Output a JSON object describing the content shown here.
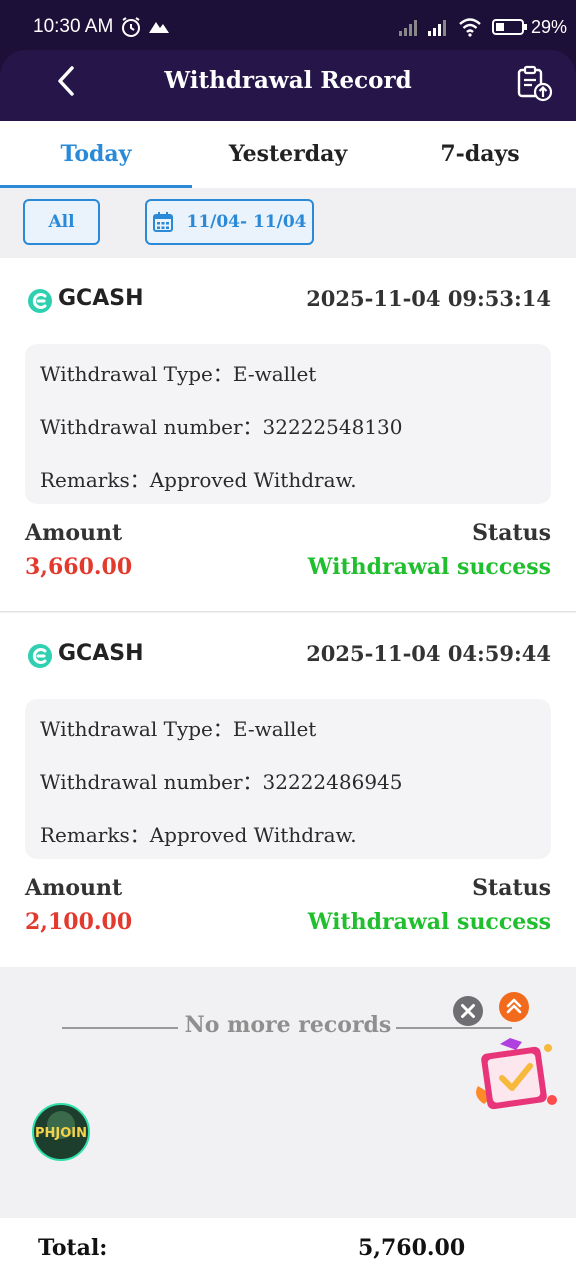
{
  "status_bar": {
    "time": "10:30 AM",
    "battery_pct": "29%",
    "icons": [
      "alarm-icon",
      "mountain-icon",
      "signal-icon",
      "signal-icon",
      "wifi-icon",
      "battery-icon"
    ]
  },
  "header": {
    "title": "Withdrawal Record",
    "back_icon": "chevron-left-icon",
    "right_icon": "clipboard-upload-icon",
    "background": "#1c0f38"
  },
  "tabs": [
    {
      "label": "Today",
      "active": true
    },
    {
      "label": "Yesterday",
      "active": false
    },
    {
      "label": "7-days",
      "active": false
    }
  ],
  "filters": {
    "all_label": "All",
    "date_range": "11/04- 11/04",
    "date_icon": "calendar-icon"
  },
  "records": [
    {
      "provider": "GCASH",
      "datetime": "2025-11-04 09:53:14",
      "type_label": "Withdrawal Type：",
      "type_value": "E-wallet",
      "number_label": "Withdrawal number：",
      "number_value": "32222548130",
      "remarks_label": "Remarks：",
      "remarks_value": "Approved Withdraw.",
      "amount_label": "Amount",
      "amount_value": "3,660.00",
      "status_label": "Status",
      "status_value": "Withdrawal success"
    },
    {
      "provider": "GCASH",
      "datetime": "2025-11-04 04:59:44",
      "type_label": "Withdrawal Type：",
      "type_value": "E-wallet",
      "number_label": "Withdrawal number：",
      "number_value": "32222486945",
      "remarks_label": "Remarks：",
      "remarks_value": "Approved Withdraw.",
      "amount_label": "Amount",
      "amount_value": "2,100.00",
      "status_label": "Status",
      "status_value": "Withdrawal success"
    }
  ],
  "no_more_text": "No more records",
  "floating": {
    "badge_text": "PHJOIN"
  },
  "footer": {
    "total_label": "Total:",
    "total_value": "5,760.00"
  },
  "colors": {
    "accent": "#2a8ad8",
    "amount": "#e23b2e",
    "success": "#1fbf2e"
  }
}
